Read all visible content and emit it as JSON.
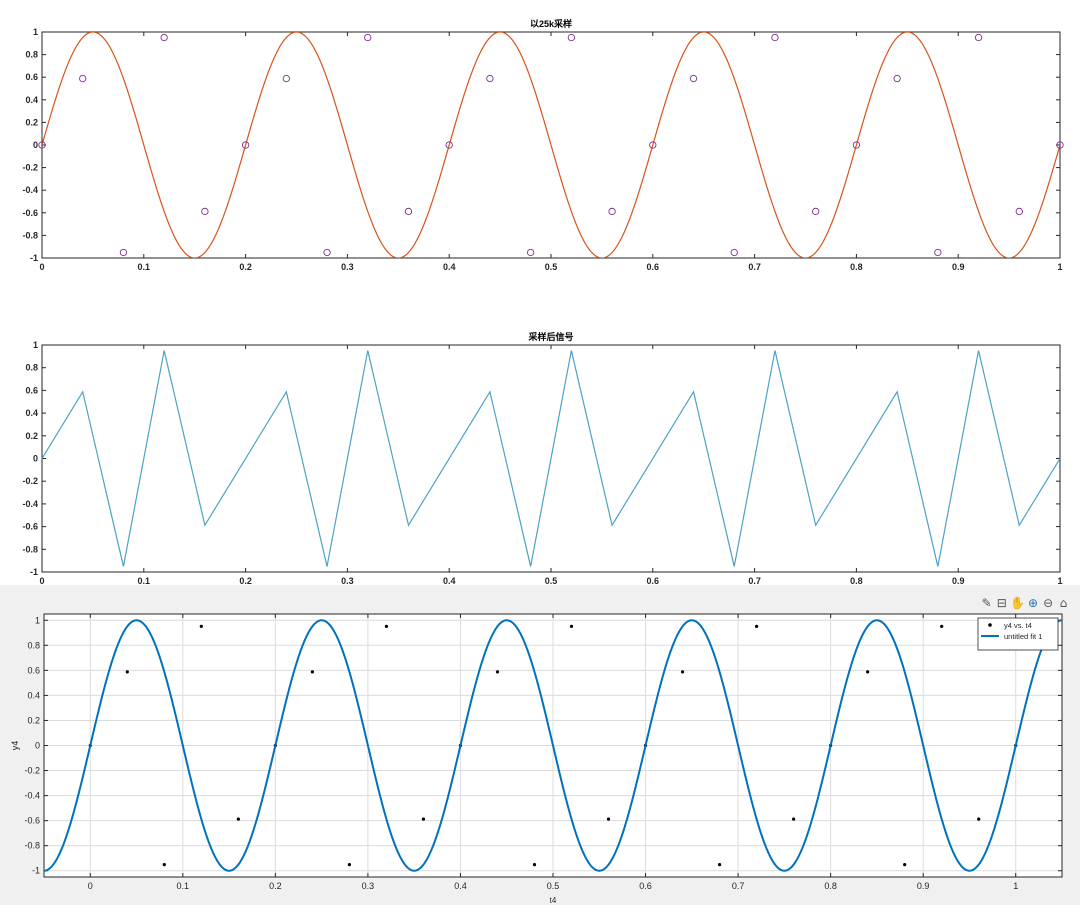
{
  "toolbar": {
    "icons": [
      "edit-plot-icon",
      "export-icon",
      "pan-icon",
      "zoom-in-icon",
      "zoom-out-icon",
      "home-icon"
    ]
  },
  "chart_data": [
    {
      "type": "line",
      "title": "以25k采样",
      "xlim": [
        0,
        1
      ],
      "ylim": [
        -1,
        1
      ],
      "grid": false,
      "xticks": [
        "0",
        "0.1",
        "0.2",
        "0.3",
        "0.4",
        "0.5",
        "0.6",
        "0.7",
        "0.8",
        "0.9",
        "1"
      ],
      "yticks": [
        "-1",
        "-0.8",
        "-0.6",
        "-0.4",
        "-0.2",
        "0",
        "0.2",
        "0.4",
        "0.6",
        "0.8",
        "1"
      ],
      "series": [
        {
          "kind": "curve",
          "function": "sin(2*pi*5*t)",
          "frequency": 5,
          "color": "#D95319"
        },
        {
          "kind": "markers",
          "marker": "circle",
          "color": "#7E2F8E",
          "x": [
            0,
            0.04,
            0.08,
            0.12,
            0.16,
            0.2,
            0.24,
            0.28,
            0.32,
            0.36,
            0.4,
            0.44,
            0.48,
            0.52,
            0.56,
            0.6,
            0.64,
            0.68,
            0.72,
            0.76,
            0.8,
            0.84,
            0.88,
            0.92,
            0.96,
            1
          ],
          "y": [
            0,
            0.588,
            -0.951,
            0.951,
            -0.588,
            0,
            0.588,
            -0.951,
            0.951,
            -0.588,
            0,
            0.588,
            -0.951,
            0.951,
            -0.588,
            0,
            0.588,
            -0.951,
            0.951,
            -0.588,
            0,
            0.588,
            -0.951,
            0.951,
            -0.588,
            0
          ]
        }
      ]
    },
    {
      "type": "line",
      "title": "采样后信号",
      "xlim": [
        0,
        1
      ],
      "ylim": [
        -1,
        1
      ],
      "grid": false,
      "xticks": [
        "0",
        "0.1",
        "0.2",
        "0.3",
        "0.4",
        "0.5",
        "0.6",
        "0.7",
        "0.8",
        "0.9",
        "1"
      ],
      "yticks": [
        "-1",
        "-0.8",
        "-0.6",
        "-0.4",
        "-0.2",
        "0",
        "0.2",
        "0.4",
        "0.6",
        "0.8",
        "1"
      ],
      "series": [
        {
          "kind": "polyline",
          "color": "#4DA1C7",
          "x": [
            0,
            0.04,
            0.08,
            0.12,
            0.16,
            0.2,
            0.24,
            0.28,
            0.32,
            0.36,
            0.4,
            0.44,
            0.48,
            0.52,
            0.56,
            0.6,
            0.64,
            0.68,
            0.72,
            0.76,
            0.8,
            0.84,
            0.88,
            0.92,
            0.96,
            1
          ],
          "y": [
            0,
            0.588,
            -0.951,
            0.951,
            -0.588,
            0,
            0.588,
            -0.951,
            0.951,
            -0.588,
            0,
            0.588,
            -0.951,
            0.951,
            -0.588,
            0,
            0.588,
            -0.951,
            0.951,
            -0.588,
            0,
            0.588,
            -0.951,
            0.951,
            -0.588,
            0
          ]
        }
      ]
    },
    {
      "type": "scatter",
      "title": "",
      "xlabel": "t4",
      "ylabel": "y4",
      "xlim": [
        -0.05,
        1.05
      ],
      "ylim": [
        -1.05,
        1.05
      ],
      "grid": true,
      "legend_position": "top-right",
      "xticks": [
        "0",
        "0.1",
        "0.2",
        "0.3",
        "0.4",
        "0.5",
        "0.6",
        "0.7",
        "0.8",
        "0.9",
        "1"
      ],
      "yticks": [
        "-1",
        "-0.8",
        "-0.6",
        "-0.4",
        "-0.2",
        "0",
        "0.2",
        "0.4",
        "0.6",
        "0.8",
        "1"
      ],
      "series": [
        {
          "kind": "markers",
          "name": "y4 vs. t4",
          "marker": "dot",
          "color": "#000000",
          "x": [
            0,
            0.04,
            0.08,
            0.12,
            0.16,
            0.2,
            0.24,
            0.28,
            0.32,
            0.36,
            0.4,
            0.44,
            0.48,
            0.52,
            0.56,
            0.6,
            0.64,
            0.68,
            0.72,
            0.76,
            0.8,
            0.84,
            0.88,
            0.92,
            0.96,
            1
          ],
          "y": [
            0,
            0.588,
            -0.951,
            0.951,
            -0.588,
            0,
            0.588,
            -0.951,
            0.951,
            -0.588,
            0,
            0.588,
            -0.951,
            0.951,
            -0.588,
            0,
            0.588,
            -0.951,
            0.951,
            -0.588,
            0,
            0.588,
            -0.951,
            0.951,
            -0.588,
            0
          ]
        },
        {
          "kind": "curve",
          "name": "untitled fit 1",
          "function": "sin(2*pi*5*t)",
          "frequency": 5,
          "color": "#0072BD"
        }
      ]
    }
  ]
}
